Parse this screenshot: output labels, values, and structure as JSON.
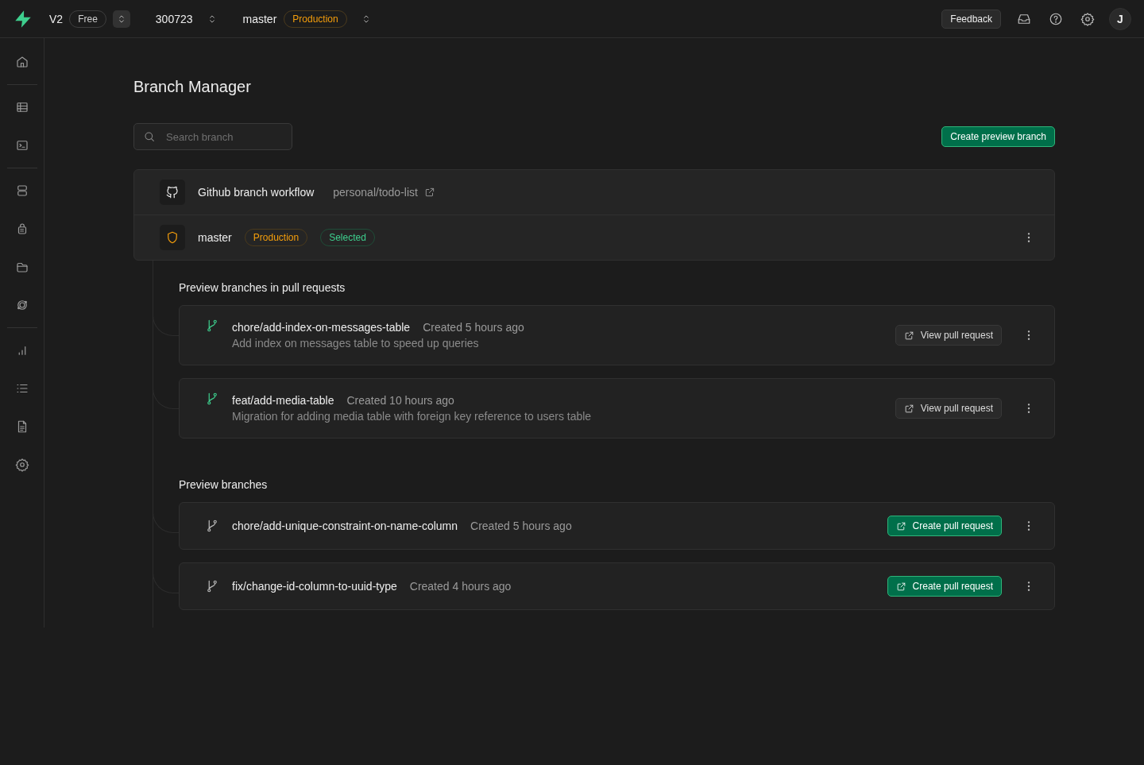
{
  "topbar": {
    "version": "V2",
    "plan": "Free",
    "project": "300723",
    "branch": "master",
    "branch_badge": "Production",
    "feedback": "Feedback",
    "avatar": "J"
  },
  "page": {
    "title": "Branch Manager",
    "search": {
      "placeholder": "Search branch"
    },
    "create_button": "Create preview branch"
  },
  "workflow": {
    "label": "Github branch workflow",
    "repo": "personal/todo-list"
  },
  "main_branch": {
    "name": "master",
    "badges": [
      {
        "label": "Production",
        "kind": "production"
      },
      {
        "label": "Selected",
        "kind": "selected"
      }
    ]
  },
  "sections": [
    {
      "title": "Preview branches in pull requests",
      "branches": [
        {
          "name": "chore/add-index-on-messages-table",
          "created": "Created 5 hours ago",
          "description": "Add index on messages table to speed up queries",
          "kind": "pr",
          "action": "View pull request"
        },
        {
          "name": "feat/add-media-table",
          "created": "Created 10 hours ago",
          "description": "Migration for adding media table with foreign key reference to users table",
          "kind": "pr",
          "action": "View pull request"
        }
      ]
    },
    {
      "title": "Preview branches",
      "branches": [
        {
          "name": "chore/add-unique-constraint-on-name-column",
          "created": "Created 5 hours ago",
          "kind": "plain",
          "action": "Create pull request"
        },
        {
          "name": "fix/change-id-column-to-uuid-type",
          "created": "Created 4 hours ago",
          "kind": "plain",
          "action": "Create pull request"
        }
      ]
    }
  ]
}
